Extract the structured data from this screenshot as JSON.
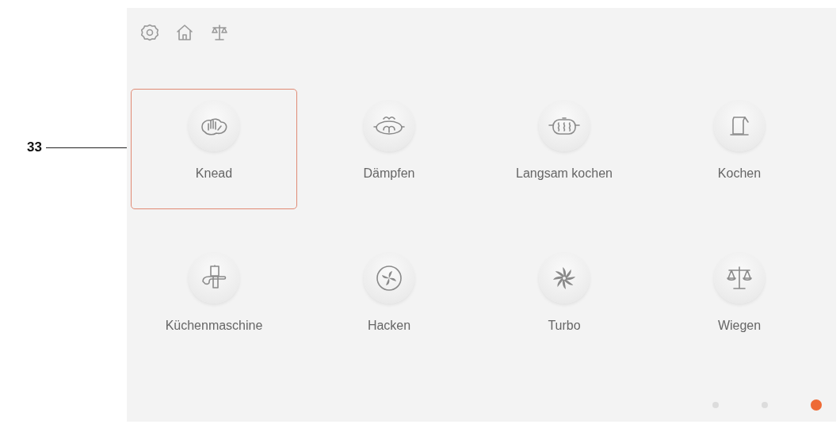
{
  "callout": {
    "label": "33"
  },
  "programs": [
    {
      "label": "Knead",
      "kind": "hand",
      "selected": true
    },
    {
      "label": "Dämpfen",
      "kind": "steamer",
      "selected": false
    },
    {
      "label": "Langsam kochen",
      "kind": "pot",
      "selected": false
    },
    {
      "label": "Kochen",
      "kind": "kettle",
      "selected": false
    },
    {
      "label": "Küchenmaschine",
      "kind": "processor",
      "selected": false
    },
    {
      "label": "Hacken",
      "kind": "fan",
      "selected": false
    },
    {
      "label": "Turbo",
      "kind": "star",
      "selected": false
    },
    {
      "label": "Wiegen",
      "kind": "scale",
      "selected": false
    }
  ],
  "pages": [
    {
      "selected": false
    },
    {
      "selected": false
    },
    {
      "selected": true
    }
  ]
}
